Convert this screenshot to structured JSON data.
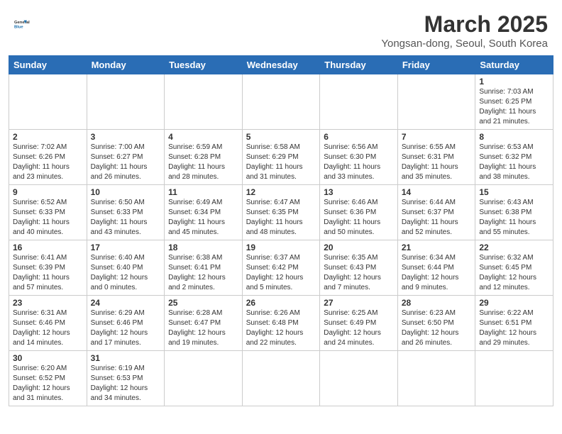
{
  "header": {
    "logo_general": "General",
    "logo_blue": "Blue",
    "month_year": "March 2025",
    "location": "Yongsan-dong, Seoul, South Korea"
  },
  "weekdays": [
    "Sunday",
    "Monday",
    "Tuesday",
    "Wednesday",
    "Thursday",
    "Friday",
    "Saturday"
  ],
  "weeks": [
    [
      {
        "day": "",
        "info": ""
      },
      {
        "day": "",
        "info": ""
      },
      {
        "day": "",
        "info": ""
      },
      {
        "day": "",
        "info": ""
      },
      {
        "day": "",
        "info": ""
      },
      {
        "day": "",
        "info": ""
      },
      {
        "day": "1",
        "info": "Sunrise: 7:03 AM\nSunset: 6:25 PM\nDaylight: 11 hours and 21 minutes."
      }
    ],
    [
      {
        "day": "2",
        "info": "Sunrise: 7:02 AM\nSunset: 6:26 PM\nDaylight: 11 hours and 23 minutes."
      },
      {
        "day": "3",
        "info": "Sunrise: 7:00 AM\nSunset: 6:27 PM\nDaylight: 11 hours and 26 minutes."
      },
      {
        "day": "4",
        "info": "Sunrise: 6:59 AM\nSunset: 6:28 PM\nDaylight: 11 hours and 28 minutes."
      },
      {
        "day": "5",
        "info": "Sunrise: 6:58 AM\nSunset: 6:29 PM\nDaylight: 11 hours and 31 minutes."
      },
      {
        "day": "6",
        "info": "Sunrise: 6:56 AM\nSunset: 6:30 PM\nDaylight: 11 hours and 33 minutes."
      },
      {
        "day": "7",
        "info": "Sunrise: 6:55 AM\nSunset: 6:31 PM\nDaylight: 11 hours and 35 minutes."
      },
      {
        "day": "8",
        "info": "Sunrise: 6:53 AM\nSunset: 6:32 PM\nDaylight: 11 hours and 38 minutes."
      }
    ],
    [
      {
        "day": "9",
        "info": "Sunrise: 6:52 AM\nSunset: 6:33 PM\nDaylight: 11 hours and 40 minutes."
      },
      {
        "day": "10",
        "info": "Sunrise: 6:50 AM\nSunset: 6:33 PM\nDaylight: 11 hours and 43 minutes."
      },
      {
        "day": "11",
        "info": "Sunrise: 6:49 AM\nSunset: 6:34 PM\nDaylight: 11 hours and 45 minutes."
      },
      {
        "day": "12",
        "info": "Sunrise: 6:47 AM\nSunset: 6:35 PM\nDaylight: 11 hours and 48 minutes."
      },
      {
        "day": "13",
        "info": "Sunrise: 6:46 AM\nSunset: 6:36 PM\nDaylight: 11 hours and 50 minutes."
      },
      {
        "day": "14",
        "info": "Sunrise: 6:44 AM\nSunset: 6:37 PM\nDaylight: 11 hours and 52 minutes."
      },
      {
        "day": "15",
        "info": "Sunrise: 6:43 AM\nSunset: 6:38 PM\nDaylight: 11 hours and 55 minutes."
      }
    ],
    [
      {
        "day": "16",
        "info": "Sunrise: 6:41 AM\nSunset: 6:39 PM\nDaylight: 11 hours and 57 minutes."
      },
      {
        "day": "17",
        "info": "Sunrise: 6:40 AM\nSunset: 6:40 PM\nDaylight: 12 hours and 0 minutes."
      },
      {
        "day": "18",
        "info": "Sunrise: 6:38 AM\nSunset: 6:41 PM\nDaylight: 12 hours and 2 minutes."
      },
      {
        "day": "19",
        "info": "Sunrise: 6:37 AM\nSunset: 6:42 PM\nDaylight: 12 hours and 5 minutes."
      },
      {
        "day": "20",
        "info": "Sunrise: 6:35 AM\nSunset: 6:43 PM\nDaylight: 12 hours and 7 minutes."
      },
      {
        "day": "21",
        "info": "Sunrise: 6:34 AM\nSunset: 6:44 PM\nDaylight: 12 hours and 9 minutes."
      },
      {
        "day": "22",
        "info": "Sunrise: 6:32 AM\nSunset: 6:45 PM\nDaylight: 12 hours and 12 minutes."
      }
    ],
    [
      {
        "day": "23",
        "info": "Sunrise: 6:31 AM\nSunset: 6:46 PM\nDaylight: 12 hours and 14 minutes."
      },
      {
        "day": "24",
        "info": "Sunrise: 6:29 AM\nSunset: 6:46 PM\nDaylight: 12 hours and 17 minutes."
      },
      {
        "day": "25",
        "info": "Sunrise: 6:28 AM\nSunset: 6:47 PM\nDaylight: 12 hours and 19 minutes."
      },
      {
        "day": "26",
        "info": "Sunrise: 6:26 AM\nSunset: 6:48 PM\nDaylight: 12 hours and 22 minutes."
      },
      {
        "day": "27",
        "info": "Sunrise: 6:25 AM\nSunset: 6:49 PM\nDaylight: 12 hours and 24 minutes."
      },
      {
        "day": "28",
        "info": "Sunrise: 6:23 AM\nSunset: 6:50 PM\nDaylight: 12 hours and 26 minutes."
      },
      {
        "day": "29",
        "info": "Sunrise: 6:22 AM\nSunset: 6:51 PM\nDaylight: 12 hours and 29 minutes."
      }
    ],
    [
      {
        "day": "30",
        "info": "Sunrise: 6:20 AM\nSunset: 6:52 PM\nDaylight: 12 hours and 31 minutes."
      },
      {
        "day": "31",
        "info": "Sunrise: 6:19 AM\nSunset: 6:53 PM\nDaylight: 12 hours and 34 minutes."
      },
      {
        "day": "",
        "info": ""
      },
      {
        "day": "",
        "info": ""
      },
      {
        "day": "",
        "info": ""
      },
      {
        "day": "",
        "info": ""
      },
      {
        "day": "",
        "info": ""
      }
    ]
  ]
}
